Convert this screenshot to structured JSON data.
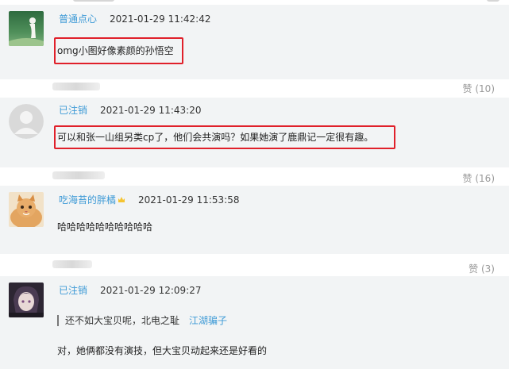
{
  "comments": [
    {
      "username": "普通点心",
      "timestamp": "2021-01-29 11:42:42",
      "text": "omg小图好像素颜的孙悟空",
      "likes_label": "赞 (10)"
    },
    {
      "username": "已注销",
      "timestamp": "2021-01-29 11:43:20",
      "text": "可以和张一山组另类cp了，他们会共演吗？如果她演了鹿鼎记一定很有趣。",
      "likes_label": "赞 (16)"
    },
    {
      "username": "吃海苔的胖橘",
      "timestamp": "2021-01-29 11:53:58",
      "text": "哈哈哈哈哈哈哈哈哈哈",
      "likes_label": "赞 (3)"
    },
    {
      "username": "已注销",
      "timestamp": "2021-01-29 12:09:27",
      "quote_text": "还不如大宝贝呢，北电之耻",
      "quote_author": "江湖骗子",
      "text": "对，她俩都没有演技，但大宝贝动起来还是好看的"
    }
  ],
  "colors": {
    "username": "#3e9ad6",
    "highlight_box": "#e0202a",
    "like": "#999999",
    "comment_bg": "#f2f4f5"
  },
  "icons": {
    "avatar_1": "avatar-green-figure",
    "avatar_2": "default-avatar-icon",
    "avatar_3": "avatar-cat",
    "avatar_4": "avatar-anime",
    "badge": "crown-badge-icon"
  }
}
